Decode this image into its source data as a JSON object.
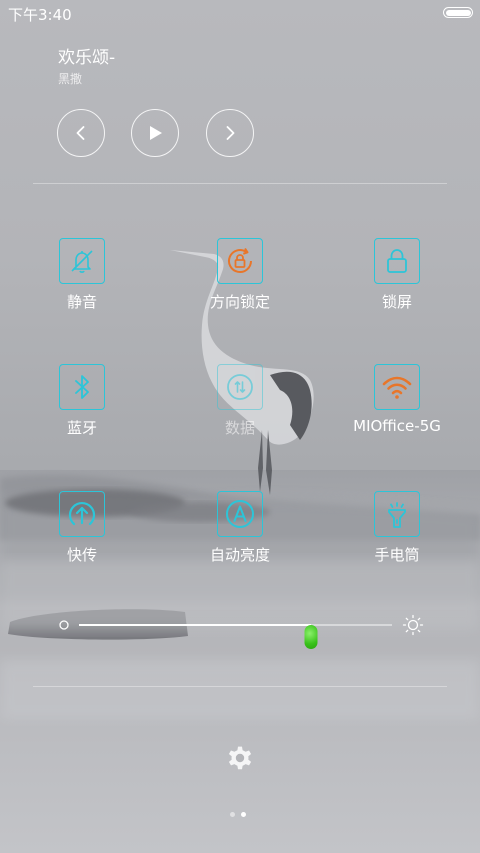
{
  "status_bar": {
    "time": "下午3:40",
    "battery_level": 1.0
  },
  "media": {
    "title": "欢乐颂-",
    "artist": "黑撒",
    "controls": [
      "previous-icon",
      "play-icon",
      "next-icon"
    ]
  },
  "toggles": [
    {
      "label": "静音",
      "icon": "silent-bell-icon",
      "state": "on"
    },
    {
      "label": "方向锁定",
      "icon": "rotation-lock-icon",
      "state": "on"
    },
    {
      "label": "锁屏",
      "icon": "lock-icon",
      "state": "on"
    },
    {
      "label": "蓝牙",
      "icon": "bluetooth-icon",
      "state": "on"
    },
    {
      "label": "数据",
      "icon": "mobile-data-icon",
      "state": "off"
    },
    {
      "label": "MIOffice-5G",
      "icon": "wifi-icon",
      "state": "on"
    },
    {
      "label": "快传",
      "icon": "quick-transfer-icon",
      "state": "on"
    },
    {
      "label": "自动亮度",
      "icon": "auto-brightness-icon",
      "state": "on"
    },
    {
      "label": "手电筒",
      "icon": "flashlight-icon",
      "state": "on"
    }
  ],
  "brightness": {
    "level": 0.74,
    "min_icon": "brightness-low-icon",
    "max_icon": "brightness-high-icon"
  },
  "settings_icon": "gear-icon",
  "pager": {
    "count": 2,
    "active_index": 1
  },
  "colors": {
    "accent_cyan": "#2cc5d8",
    "accent_orange": "#e8762a",
    "thumb_green": "#39c21a"
  }
}
